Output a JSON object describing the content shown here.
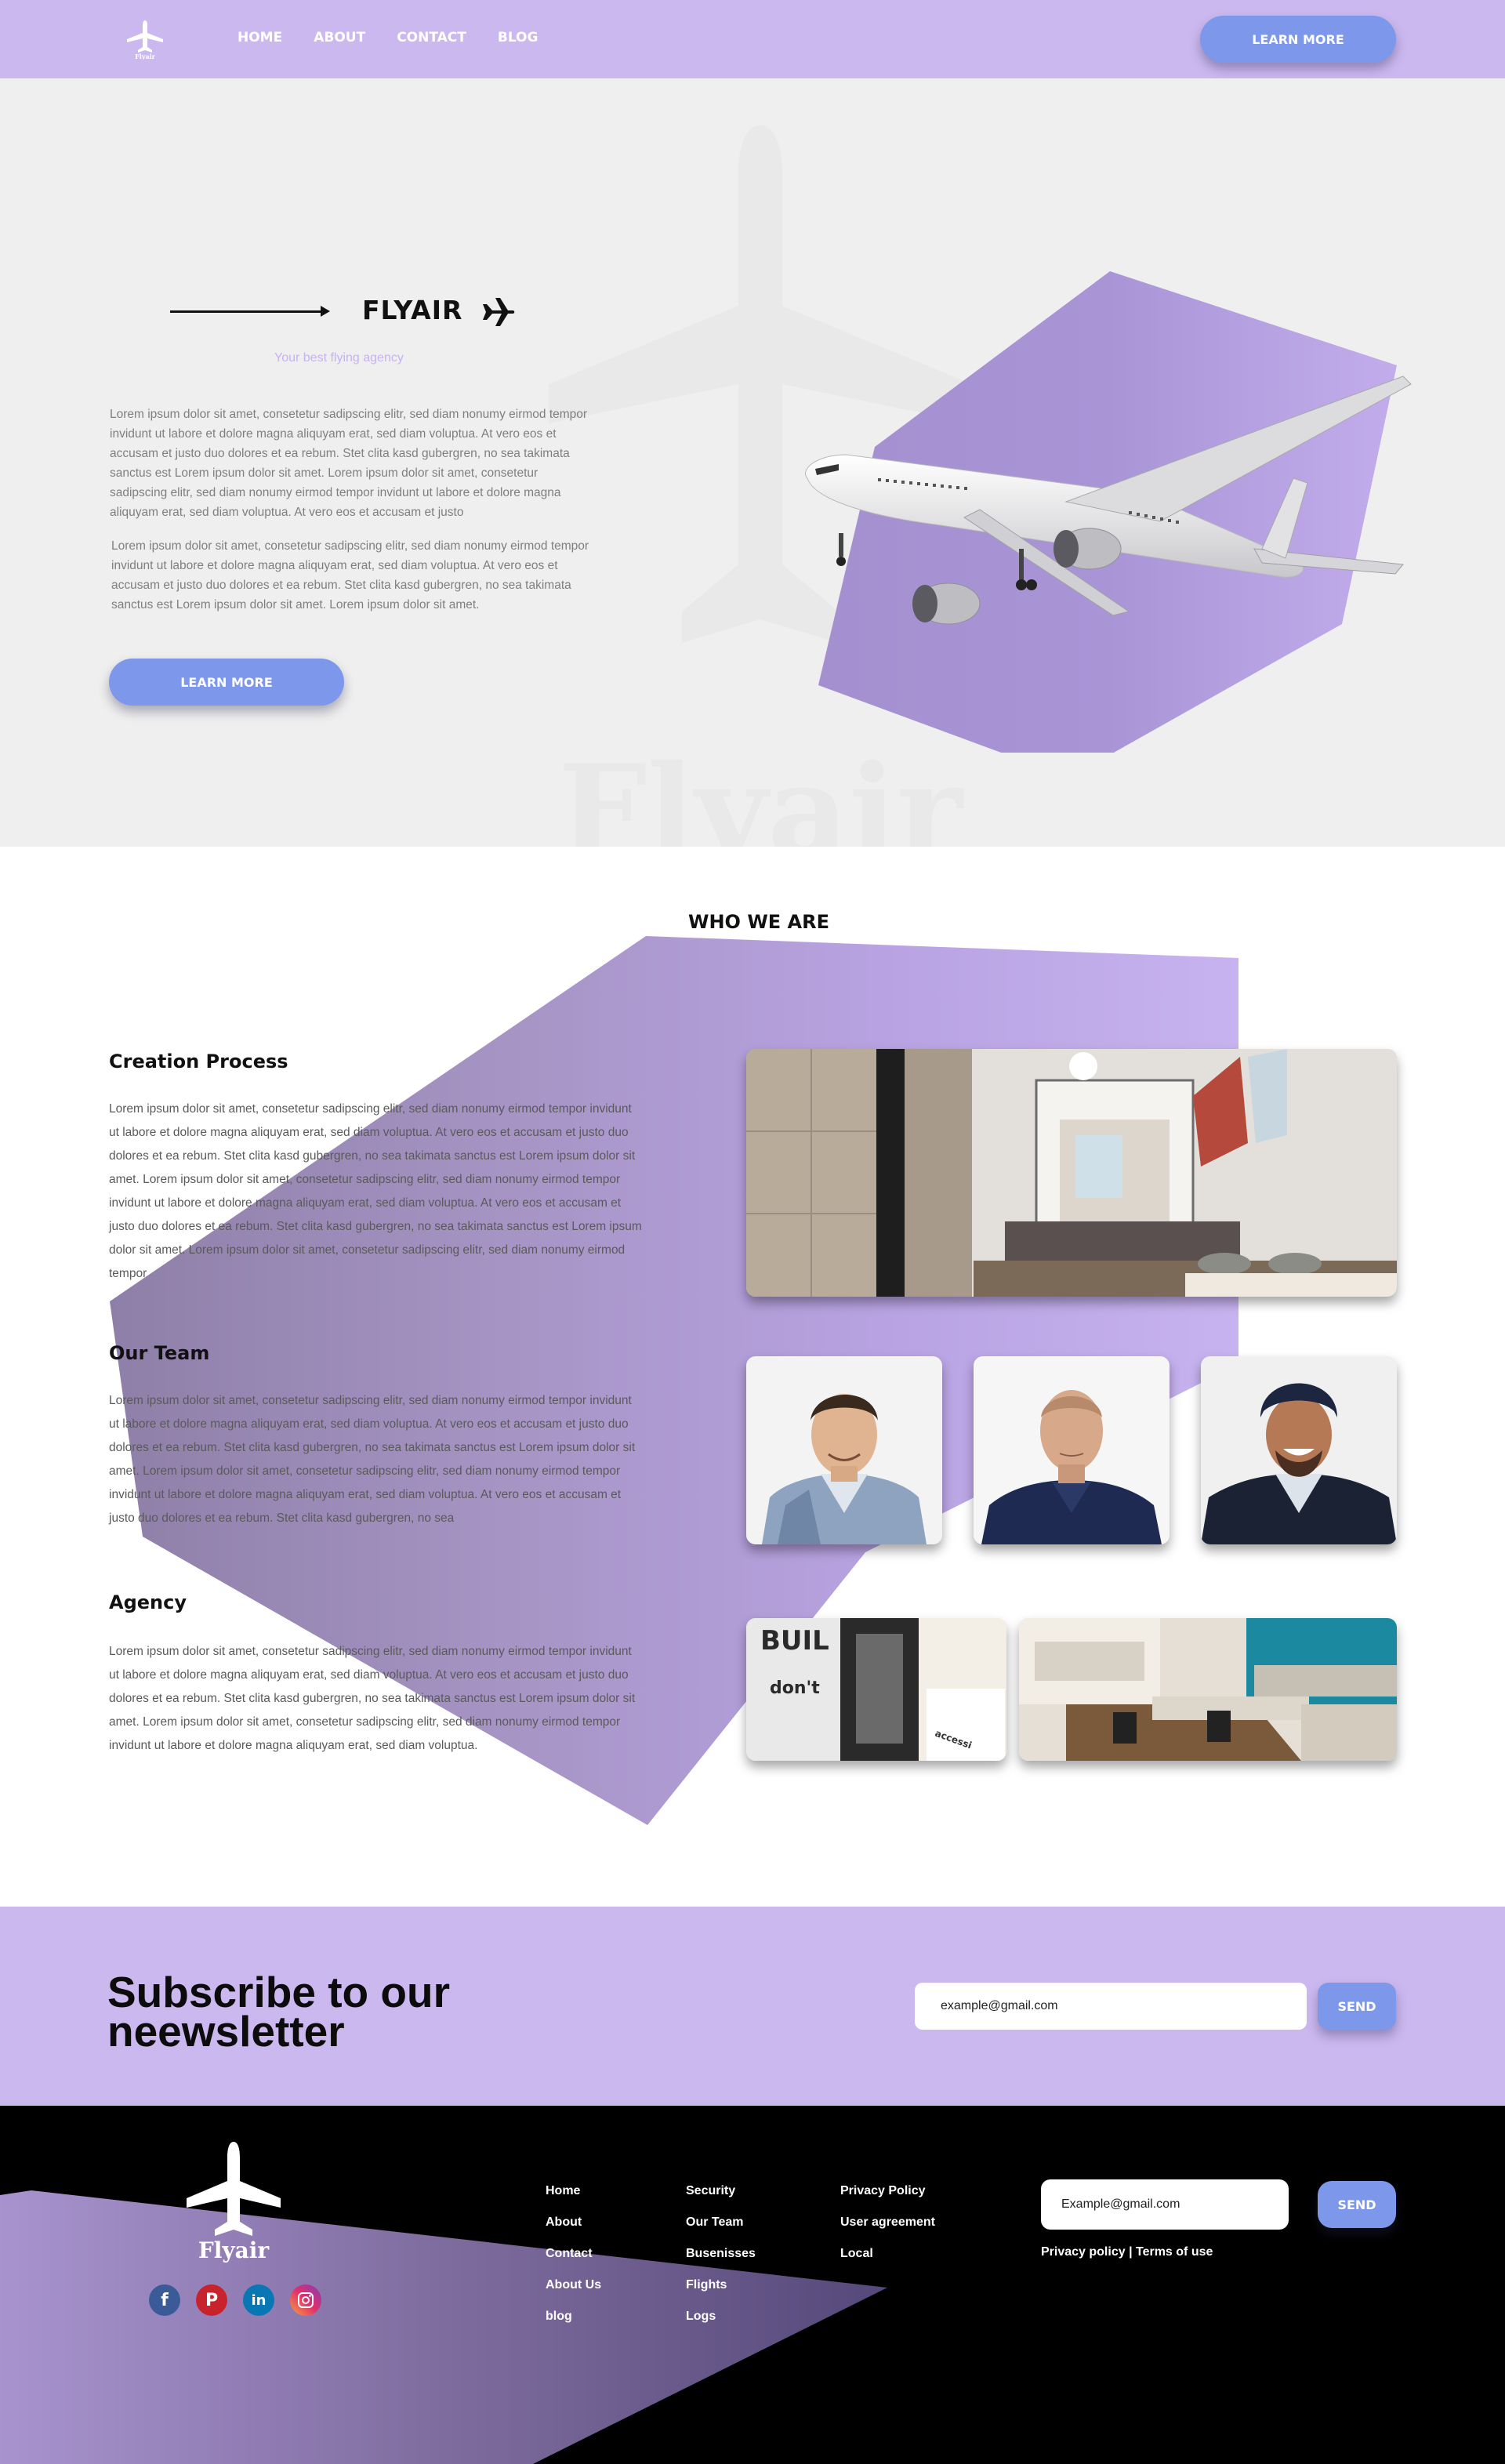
{
  "nav": {
    "logo_text": "Flyair",
    "links": [
      "HOME",
      "ABOUT",
      "CONTACT",
      "BLOG"
    ],
    "cta": "LEARN MORE"
  },
  "hero": {
    "title": "FLYAIR",
    "subtitle": "Your best flying agency",
    "watermark_text": "Flyair",
    "paragraph1": "Lorem ipsum dolor sit amet, consetetur sadipscing elitr, sed diam nonumy eirmod tempor invidunt ut labore et dolore magna aliquyam erat, sed diam voluptua. At vero eos et accusam et justo duo dolores et ea rebum. Stet clita kasd gubergren, no sea takimata sanctus est Lorem ipsum dolor sit amet. Lorem ipsum dolor sit amet, consetetur sadipscing elitr, sed diam nonumy eirmod tempor invidunt ut labore et dolore magna aliquyam erat, sed diam voluptua. At vero eos et accusam et justo",
    "paragraph2": "Lorem ipsum dolor sit amet, consetetur sadipscing elitr, sed diam nonumy eirmod tempor invidunt ut labore et dolore magna aliquyam erat, sed diam voluptua. At vero eos et accusam et justo duo dolores et ea rebum. Stet clita kasd gubergren, no sea takimata sanctus est Lorem ipsum dolor sit amet. Lorem ipsum dolor sit amet.",
    "cta": "LEARN MORE"
  },
  "who": {
    "title": "WHO WE ARE",
    "creation": {
      "heading": "Creation Process",
      "text": "Lorem ipsum dolor sit amet, consetetur sadipscing elitr, sed diam nonumy eirmod tempor invidunt ut labore et dolore magna aliquyam erat, sed diam voluptua. At vero eos et accusam et justo duo dolores et ea rebum. Stet clita kasd gubergren, no sea takimata sanctus est Lorem ipsum dolor sit amet. Lorem ipsum dolor sit amet, consetetur sadipscing elitr, sed diam nonumy eirmod tempor invidunt ut labore et dolore magna aliquyam erat, sed diam voluptua. At vero eos et accusam et justo duo dolores et ea rebum. Stet clita kasd gubergren, no sea takimata sanctus est Lorem ipsum dolor sit amet. Lorem ipsum dolor sit amet, consetetur sadipscing elitr, sed diam nonumy eirmod tempor"
    },
    "team": {
      "heading": "Our Team",
      "text": "Lorem ipsum dolor sit amet, consetetur sadipscing elitr, sed diam nonumy eirmod tempor invidunt ut labore et dolore magna aliquyam erat, sed diam voluptua. At vero eos et accusam et justo duo dolores et ea rebum. Stet clita kasd gubergren, no sea takimata sanctus est Lorem ipsum dolor sit amet. Lorem ipsum dolor sit amet, consetetur sadipscing elitr, sed diam nonumy eirmod tempor invidunt ut labore et dolore magna aliquyam erat, sed diam voluptua. At vero eos et accusam et justo duo dolores et ea rebum. Stet clita kasd gubergren, no sea"
    },
    "agency": {
      "heading": "Agency",
      "text": "Lorem ipsum dolor sit amet, consetetur sadipscing elitr, sed diam nonumy eirmod tempor invidunt ut labore et dolore magna aliquyam erat, sed diam voluptua. At vero eos et accusam et justo duo dolores et ea rebum. Stet clita kasd gubergren, no sea takimata sanctus est Lorem ipsum dolor sit amet. Lorem ipsum dolor sit amet, consetetur sadipscing elitr, sed diam nonumy eirmod tempor invidunt ut labore et dolore magna aliquyam erat, sed diam voluptua."
    },
    "office_wall_text_1": "BUIL",
    "office_wall_text_2": "don't",
    "office_wall_text_3": "accessi"
  },
  "subscribe": {
    "title": "Subscribe to our neewsletter",
    "input_value": "example@gmail.com",
    "button": "SEND"
  },
  "footer": {
    "logo_text": "Flyair",
    "socials": [
      "facebook-icon",
      "pinterest-icon",
      "linkedin-icon",
      "instagram-icon"
    ],
    "col1": [
      "Home",
      "About",
      "Contact",
      "About Us",
      "blog"
    ],
    "col2": [
      "Security",
      "Our Team",
      "Busenisses",
      "Flights",
      "Logs"
    ],
    "col3": [
      "Privacy Policy",
      "User agreement",
      "Local"
    ],
    "input_value": "Example@gmail.com",
    "button": "SEND",
    "legal": "Privacy policy | Terms of use"
  },
  "colors": {
    "lavender": "#cbb8ef",
    "button_blue": "#7d97ea",
    "purple_shape": "#a994d6",
    "hero_bg": "#efefef",
    "footer_bg": "#000000"
  }
}
